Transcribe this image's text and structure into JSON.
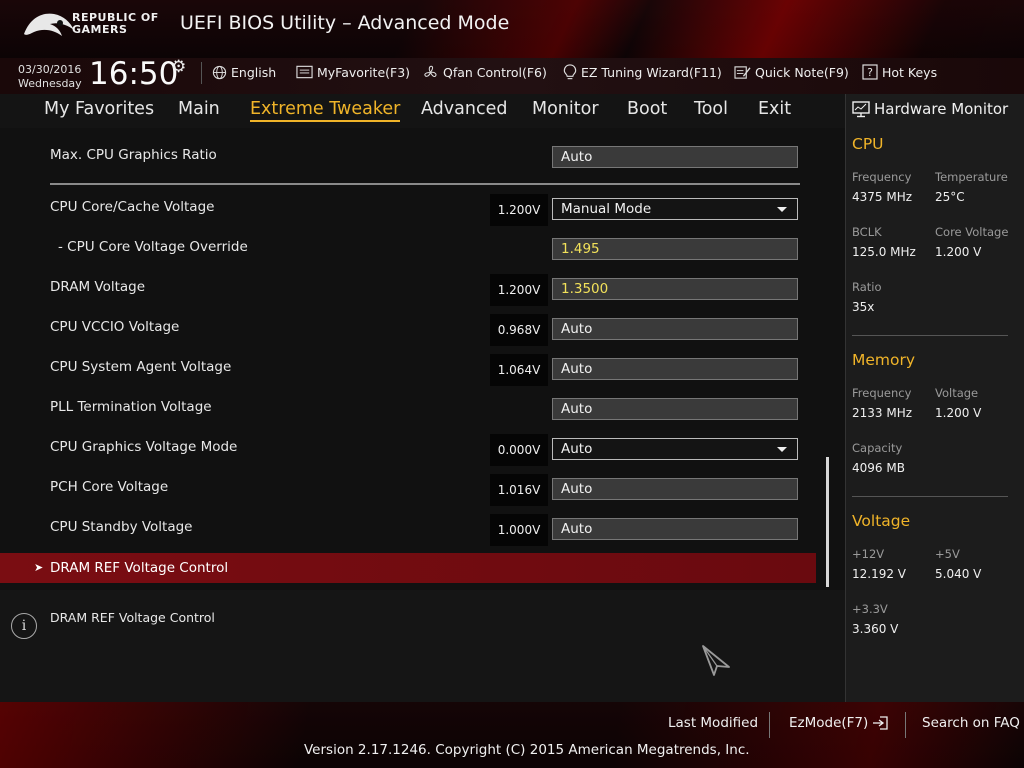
{
  "header": {
    "brand_line1": "REPUBLIC OF",
    "brand_line2": "GAMERS",
    "title": "UEFI BIOS Utility – Advanced Mode"
  },
  "info_bar": {
    "date": "03/30/2016",
    "weekday": "Wednesday",
    "time": "16:50",
    "language": "English",
    "my_favorite": "MyFavorite(F3)",
    "qfan": "Qfan Control(F6)",
    "ez_tuning": "EZ Tuning Wizard(F11)",
    "quick_note": "Quick Note(F9)",
    "hot_keys": "Hot Keys"
  },
  "tabs": [
    {
      "label": "My Favorites",
      "active": false
    },
    {
      "label": "Main",
      "active": false
    },
    {
      "label": "Extreme Tweaker",
      "active": true
    },
    {
      "label": "Advanced",
      "active": false
    },
    {
      "label": "Monitor",
      "active": false
    },
    {
      "label": "Boot",
      "active": false
    },
    {
      "label": "Tool",
      "active": false
    },
    {
      "label": "Exit",
      "active": false
    }
  ],
  "settings": [
    {
      "label": "Max. CPU Graphics Ratio",
      "reading": "",
      "value": "Auto"
    },
    {
      "label": "CPU Core/Cache Voltage",
      "reading": "1.200V",
      "value": "Manual Mode"
    },
    {
      "label": "- CPU Core Voltage Override",
      "reading": "",
      "value": "1.495"
    },
    {
      "label": "DRAM Voltage",
      "reading": "1.200V",
      "value": "1.3500"
    },
    {
      "label": "CPU VCCIO Voltage",
      "reading": "0.968V",
      "value": "Auto"
    },
    {
      "label": "CPU System Agent Voltage",
      "reading": "1.064V",
      "value": "Auto"
    },
    {
      "label": "PLL Termination Voltage",
      "reading": "",
      "value": "Auto"
    },
    {
      "label": "CPU Graphics Voltage Mode",
      "reading": "0.000V",
      "value": "Auto"
    },
    {
      "label": "PCH Core Voltage",
      "reading": "1.016V",
      "value": "Auto"
    },
    {
      "label": "CPU Standby Voltage",
      "reading": "1.000V",
      "value": "Auto"
    }
  ],
  "submenu": {
    "label": "DRAM REF Voltage Control"
  },
  "help": {
    "text": "DRAM REF Voltage Control"
  },
  "hw_monitor": {
    "title": "Hardware Monitor",
    "cpu": {
      "heading": "CPU",
      "frequency_label": "Frequency",
      "frequency": "4375 MHz",
      "temperature_label": "Temperature",
      "temperature": "25°C",
      "bclk_label": "BCLK",
      "bclk": "125.0 MHz",
      "core_voltage_label": "Core Voltage",
      "core_voltage": "1.200 V",
      "ratio_label": "Ratio",
      "ratio": "35x"
    },
    "memory": {
      "heading": "Memory",
      "frequency_label": "Frequency",
      "frequency": "2133 MHz",
      "voltage_label": "Voltage",
      "voltage": "1.200 V",
      "capacity_label": "Capacity",
      "capacity": "4096 MB"
    },
    "voltage": {
      "heading": "Voltage",
      "v12_label": "+12V",
      "v12": "12.192 V",
      "v5_label": "+5V",
      "v5": "5.040 V",
      "v33_label": "+3.3V",
      "v33": "3.360 V"
    }
  },
  "footer": {
    "last_modified": "Last Modified",
    "ez_mode": "EzMode(F7)",
    "search_faq": "Search on FAQ",
    "copyright": "Version 2.17.1246. Copyright (C) 2015 American Megatrends, Inc."
  },
  "colors": {
    "accent": "#f0b429",
    "selected_row": "#7a0d12",
    "value_highlight": "#f2e15a"
  }
}
